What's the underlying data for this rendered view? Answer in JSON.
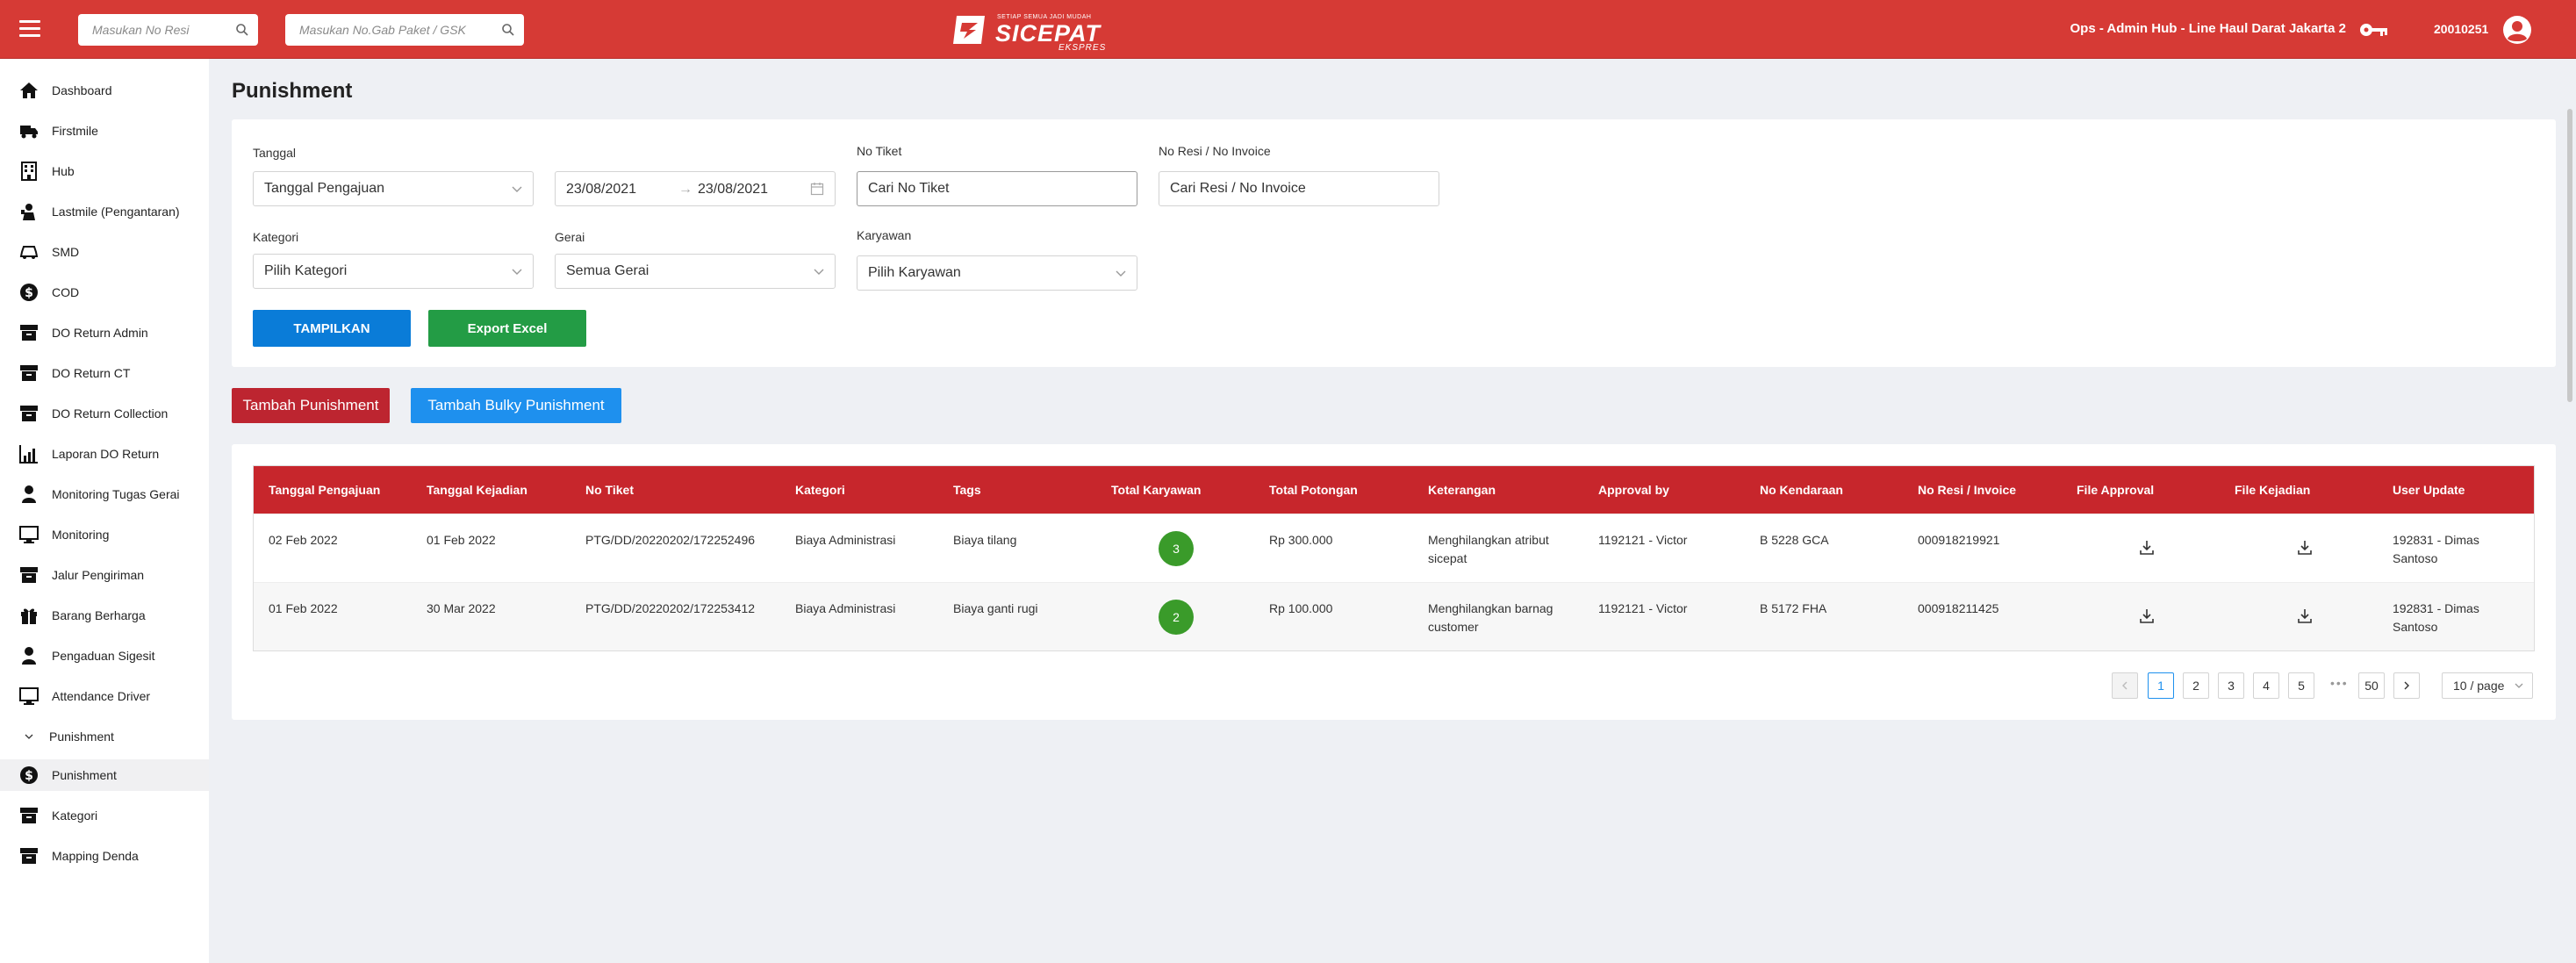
{
  "header": {
    "search_resi_placeholder": "Masukan No Resi",
    "search_gab_placeholder": "Masukan No.Gab Paket / GSK",
    "logo_tagline": "SETIAP SEMUA JADI MUDAH",
    "logo_name": "SICEPAT",
    "logo_sub": "EKSPRES",
    "user_role": "Ops - Admin Hub - Line Haul Darat Jakarta 2",
    "user_id": "20010251",
    "brand_color": "#d63a35"
  },
  "sidebar": {
    "items": [
      {
        "label": "Dashboard",
        "icon": "home-icon"
      },
      {
        "label": "Firstmile",
        "icon": "truck-icon"
      },
      {
        "label": "Hub",
        "icon": "building-icon"
      },
      {
        "label": "Lastmile (Pengantaran)",
        "icon": "courier-icon"
      },
      {
        "label": "SMD",
        "icon": "car-icon"
      },
      {
        "label": "COD",
        "icon": "dollar-icon"
      },
      {
        "label": "DO Return Admin",
        "icon": "archive-icon"
      },
      {
        "label": "DO Return CT",
        "icon": "archive-icon"
      },
      {
        "label": "DO Return Collection",
        "icon": "archive-icon"
      },
      {
        "label": "Laporan DO Return",
        "icon": "chart-icon"
      },
      {
        "label": "Monitoring Tugas Gerai",
        "icon": "person-icon"
      },
      {
        "label": "Monitoring",
        "icon": "monitor-icon"
      },
      {
        "label": "Jalur Pengiriman",
        "icon": "archive-icon"
      },
      {
        "label": "Barang Berharga",
        "icon": "gift-icon"
      },
      {
        "label": "Pengaduan Sigesit",
        "icon": "person-icon"
      },
      {
        "label": "Attendance Driver",
        "icon": "monitor-icon"
      }
    ],
    "group_label": "Punishment",
    "sub_items": [
      {
        "label": "Punishment",
        "icon": "dollar-icon"
      },
      {
        "label": "Kategori",
        "icon": "archive-icon"
      },
      {
        "label": "Mapping Denda",
        "icon": "archive-icon"
      }
    ]
  },
  "page": {
    "title": "Punishment"
  },
  "filters": {
    "tanggal_label": "Tanggal",
    "tanggal_value": "Tanggal Pengajuan",
    "date_from": "23/08/2021",
    "date_to": "23/08/2021",
    "date_arrow": "→",
    "no_tiket_label": "No Tiket",
    "no_tiket_placeholder": "Cari No Tiket",
    "no_resi_label": "No Resi  / No Invoice",
    "no_resi_placeholder": "Cari  Resi / No Invoice",
    "kategori_label": "Kategori",
    "kategori_value": "Pilih Kategori",
    "gerai_label": "Gerai",
    "gerai_value": "Semua Gerai",
    "karyawan_label": "Karyawan",
    "karyawan_value": "Pilih Karyawan",
    "btn_tampilkan": "TAMPILKAN",
    "btn_export": "Export Excel"
  },
  "actions": {
    "tambah": "Tambah Punishment",
    "tambah_bulky": "Tambah Bulky Punishment"
  },
  "table": {
    "columns": [
      "Tanggal Pengajuan",
      "Tanggal Kejadian",
      "No Tiket",
      "Kategori",
      "Tags",
      "Total Karyawan",
      "Total Potongan",
      "Keterangan",
      "Approval by",
      "No Kendaraan",
      "No Resi / Invoice",
      "File Approval",
      "File Kejadian",
      "User Update"
    ],
    "rows": [
      {
        "tanggal_pengajuan": "02 Feb 2022",
        "tanggal_kejadian": "01 Feb 2022",
        "no_tiket": "PTG/DD/20220202/172252496",
        "kategori": "Biaya Administrasi",
        "tags": "Biaya tilang",
        "total_karyawan": "3",
        "total_potongan": "Rp 300.000",
        "keterangan": "Menghilangkan atribut sicepat",
        "approval_by": "1192121 - Victor",
        "no_kendaraan": "B 5228 GCA",
        "no_resi": "000918219921",
        "user_update": "192831 - Dimas Santoso"
      },
      {
        "tanggal_pengajuan": "01 Feb 2022",
        "tanggal_kejadian": "30 Mar 2022",
        "no_tiket": "PTG/DD/20220202/172253412",
        "kategori": "Biaya Administrasi",
        "tags": "Biaya ganti rugi",
        "total_karyawan": "2",
        "total_potongan": "Rp 100.000",
        "keterangan": "Menghilangkan barnag customer",
        "approval_by": "1192121 - Victor",
        "no_kendaraan": "B 5172 FHA",
        "no_resi": "000918211425",
        "user_update": "192831 - Dimas Santoso"
      }
    ]
  },
  "pagination": {
    "pages": [
      "1",
      "2",
      "3",
      "4",
      "5"
    ],
    "ellipsis": "•••",
    "last": "50",
    "current": "1",
    "page_size": "10 / page"
  }
}
